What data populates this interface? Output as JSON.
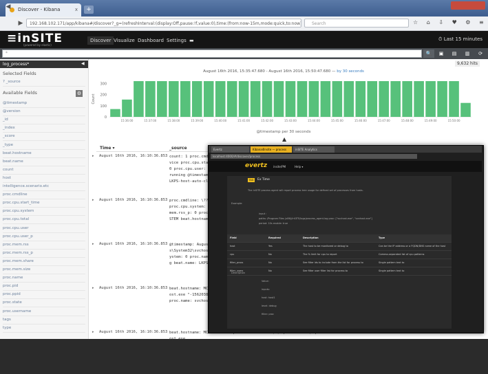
{
  "browser": {
    "tab_title": "Discover - Kibana",
    "tab_close": "x",
    "new_tab": "+",
    "url": "192.168.102.171/app/kibana#/discover?_g=(refreshInterval:(display:Off,pause:!f,value:0),time:(from:now-15m,mode:quick,to:now))&_a=(columns:!(_source),index:'log_process*',interval:auto,query:(query_string:(analyze_wildcard:!t,query:'*')),sort:!('@timestamp',desc))",
    "search_placeholder": "Search",
    "nav": {
      "back": "◀",
      "forward": "▶",
      "reload": "↻"
    },
    "toolbar_icons": "☆ ⌂ ⇩ ♥ ⚙ ≡"
  },
  "app": {
    "logo": "≡inSITE",
    "logo_sub": "(powered by elastic)",
    "nav": [
      "Discover",
      "Visualize",
      "Dashboard",
      "Settings"
    ],
    "nav_extra": "▬",
    "time_picker": "⏱ Last 15 minutes"
  },
  "query": {
    "value": "*",
    "search_icon": "🔍",
    "buttons": [
      "▣",
      "▤",
      "▥",
      "⟳"
    ]
  },
  "sidebar": {
    "index": "log_process*",
    "collapse": "◀",
    "selected_fields": "Selected Fields",
    "selected_source": "? _source",
    "available_fields": "Available Fields",
    "settings_icon": "⚙",
    "fields": [
      "@timestamp",
      "@version",
      "_id",
      "_index",
      "_score",
      "_type",
      "beat.hostname",
      "beat.name",
      "count",
      "host",
      "intelligence.scenario.etc",
      "proc.cmdline",
      "proc.cpu.start_time",
      "proc.cpu.system",
      "proc.cpu.total",
      "proc.cpu.user",
      "proc.cpu.user_p",
      "proc.mem.rss",
      "proc.mem.rss_p",
      "proc.mem.share",
      "proc.mem.size",
      "proc.name",
      "proc.pid",
      "proc.ppid",
      "proc.state",
      "proc.username",
      "tags",
      "type"
    ]
  },
  "discover": {
    "hits": "9,632 hits",
    "date_range": "August 16th 2016, 15:35:47.680 - August 16th 2016, 15:50:47.680 — ",
    "scale_link": "by 30 seconds",
    "columns": [
      "Time ▾",
      "_source"
    ],
    "expand_arrow": "▲",
    "rows": [
      {
        "time": "August 16th 2016, 16:10:36.853",
        "source": "count: 1 proc.cmdline: C:\\Windows\\System32\\svchost.exe -k LocalService proc.cpu.start_time: 1,210 proc.cpu.system: 0 proc.cpu.total: 0 proc.cpu.user: 0.005 proc.pid: 7,236 proc.ppid: 656 proc.state: running @timestamp: August 16th 2016, 16:10:36.853 beat.hostname: LKPS-host-auto-clt"
      },
      {
        "time": "August 16th 2016, 16:10:36.853",
        "source": "proc.cmdline: \\??\\C:\\Windows\\system32\\conhost.exe proc.cpu.user: 0 proc.cpu.system: 0 proc.mem.rss: 2,940 proc.mem.rss_p: 0.266 proc.mem.rss_p: 0 proc.name: conhost.exe proc.username: NT AUTHORITY\\SYSTEM beat.hostname: LKPS beat.name: LKPS"
      },
      {
        "time": "August 16th 2016, 16:10:36.853",
        "source": "@timestamp: August 16th 2016, 16:10:36.853 proc.cmdline: C:\\Windows\\System32\\svchost.exe -k netsvcs proc.cpu.user: 52,962 proc.cpu.system: 0 proc.name: svchost.exe proc.pid: 1,012 proc.state: running beat.name: LKPS beat.hostname: LKPS"
      },
      {
        "time": "August 16th 2016, 16:10:36.853",
        "source": "beat.hostname: MCJOFFEN9104 proc.cmdline: C:\\Windows\\System32\\conhost.exe \"-1562038\" system: 11 proc.cpu.user: 0 proc.mem.rss: 36 0 proc.name: svchost.exe proc.pid: 412"
      },
      {
        "time": "August 16th 2016, 16:10:36.853",
        "source": "beat.hostname: MCJOFFEN9104 proc.cmdline: ana\\x\\tophost-1.1.3\\tophost.exe"
      }
    ]
  },
  "chart_data": {
    "type": "bar",
    "title": "",
    "xlabel": "@timestamp per 30 seconds",
    "ylabel": "Count",
    "ylim": [
      0,
      320
    ],
    "yticks": [
      0,
      100,
      200,
      300
    ],
    "tick_labels": [
      "15:36:00",
      "15:37:00",
      "15:38:00",
      "15:39:00",
      "15:40:00",
      "15:41:00",
      "15:42:00",
      "15:43:00",
      "15:44:00",
      "15:45:00",
      "15:46:00",
      "15:47:00",
      "15:48:00",
      "15:49:00",
      "15:50:00"
    ],
    "values": [
      70,
      155,
      320,
      320,
      320,
      320,
      320,
      320,
      320,
      320,
      320,
      320,
      320,
      320,
      320,
      320,
      320,
      320,
      320,
      320,
      320,
      320,
      320,
      320,
      320,
      320,
      320,
      320,
      320,
      320,
      125
    ],
    "bar_color": "#57c17b"
  },
  "overlay": {
    "tabs": [
      "Evertz",
      "Kibana4Insite — process",
      "inSITE Analytics"
    ],
    "url": "localhost:4000/#/discover/process",
    "logo": "evertz",
    "logo_sub": "insite/PM",
    "nav": "Help ▾",
    "badge": "TAG",
    "title": "Ex Time",
    "lines": [
      "The inSITE process agent will report process tree usage for defined set of processes from hosts.",
      "Example:",
      "input :",
      "  paths: /Program Files (x86)/inSITE/logs/process_agent.log   proc: [\"svchost.exe\", \"conhost.exe\"]",
      "  period: 10s   enable: true"
    ],
    "table_headers": [
      "Field",
      "Required",
      "Description",
      "Type"
    ],
    "table_rows": [
      [
        "host",
        "Yes",
        "The host to be monitored or debug to",
        "Can be the IP address or a FQDN/DNS name of the host"
      ],
      [
        "cpu",
        "No",
        "The % limit for cpu to report",
        "Comma-separated list of cpu patterns"
      ],
      [
        "filter_procs",
        "No",
        "See filter ids to include from the list for process to",
        "Single pattern text to"
      ],
      [
        "filter_users",
        "No",
        "See filter user filter list for process to",
        "Single pattern text to"
      ]
    ],
    "footer": [
      "Description",
      "Value:",
      "inputs:",
      "  host: host1",
      "  level: debug",
      "  filter: proc"
    ]
  }
}
